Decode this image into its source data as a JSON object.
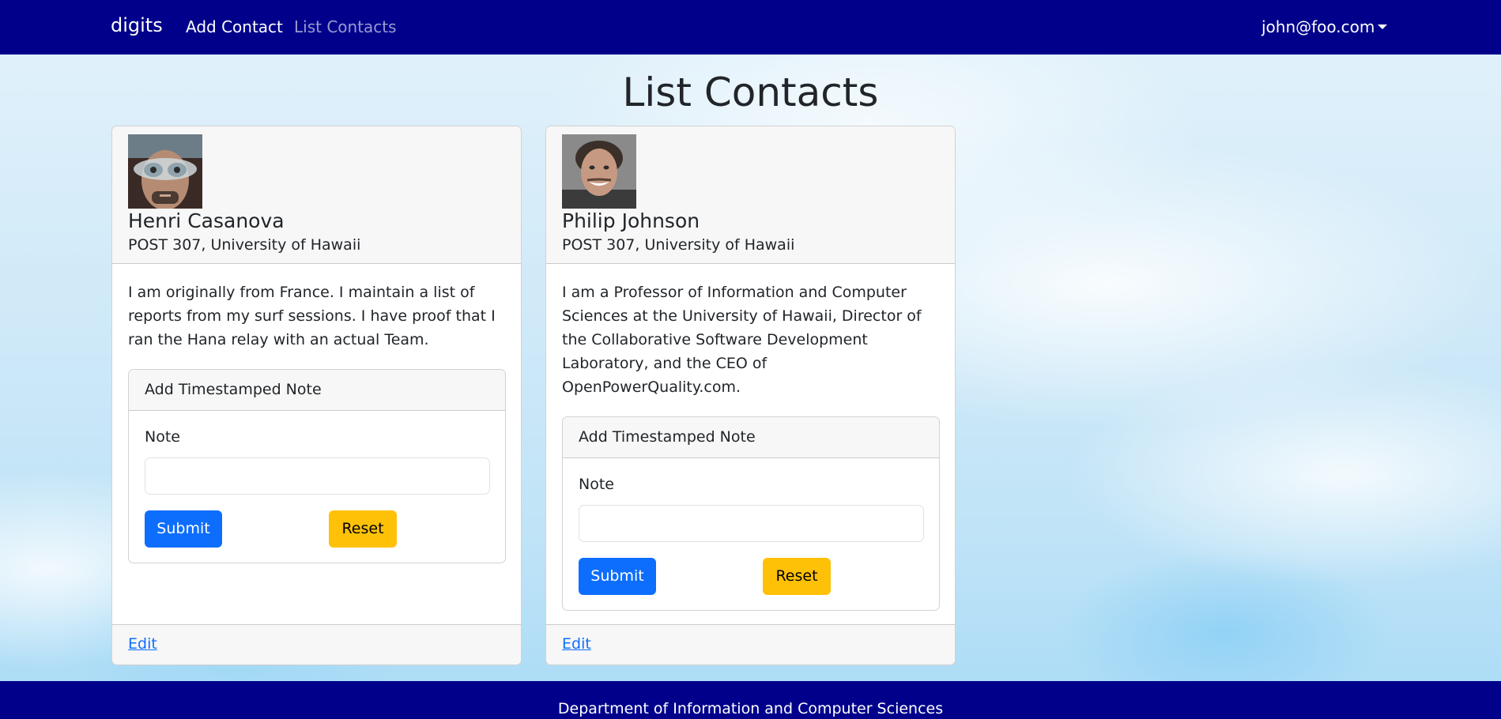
{
  "navbar": {
    "brand": "digits",
    "links": [
      {
        "label": "Add Contact",
        "active": true
      },
      {
        "label": "List Contacts",
        "active": false
      }
    ],
    "user": "john@foo.com",
    "bg_color": "#00008b"
  },
  "page": {
    "title": "List Contacts"
  },
  "contacts": [
    {
      "name": "Henri Casanova",
      "address": "POST 307, University of Hawaii",
      "description": "I am originally from France. I maintain a list of reports from my surf sessions. I have proof that I ran the Hana relay with an actual Team.",
      "note_form": {
        "header": "Add Timestamped Note",
        "label": "Note",
        "value": "",
        "submit_label": "Submit",
        "reset_label": "Reset"
      },
      "edit_label": "Edit"
    },
    {
      "name": "Philip Johnson",
      "address": "POST 307, University of Hawaii",
      "description": "I am a Professor of Information and Computer Sciences at the University of Hawaii, Director of the Collaborative Software Development Laboratory, and the CEO of OpenPowerQuality.com.",
      "note_form": {
        "header": "Add Timestamped Note",
        "label": "Note",
        "value": "",
        "submit_label": "Submit",
        "reset_label": "Reset"
      },
      "edit_label": "Edit"
    }
  ],
  "footer": {
    "text": "Department of Information and Computer Sciences"
  },
  "colors": {
    "primary": "#0d6efd",
    "warning": "#ffc107",
    "navbar": "#00008b"
  }
}
